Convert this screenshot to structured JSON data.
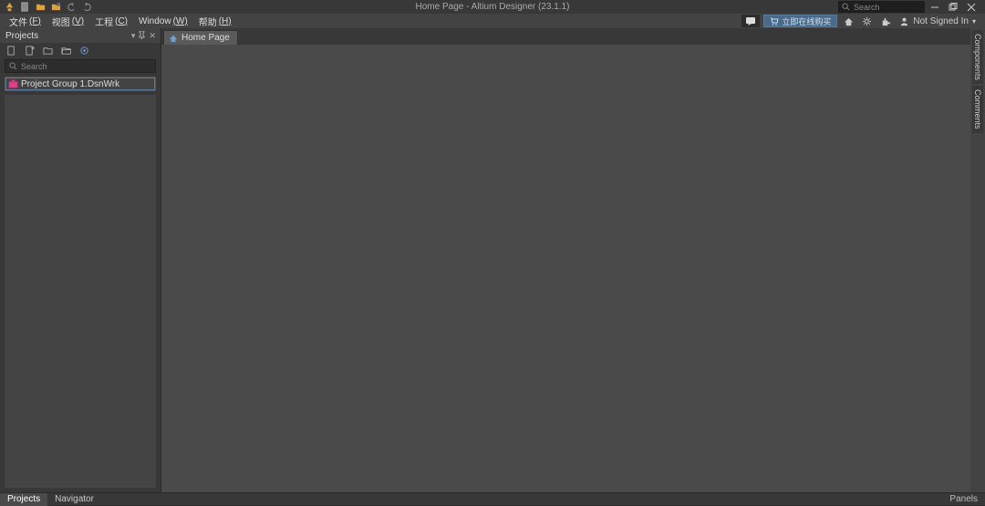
{
  "title": "Home Page - Altium Designer (23.1.1)",
  "titlebar": {
    "search_placeholder": "Search"
  },
  "menus": {
    "file": "文件",
    "file_u": "(F)",
    "view": "视图",
    "view_u": "(V)",
    "project": "工程",
    "project_u": "(C)",
    "window": "Window",
    "window_u": "(W)",
    "help": "帮助",
    "help_u": "(H)"
  },
  "menubar_right": {
    "buy_now": "立即在线购买",
    "signin": "Not Signed In",
    "signin_caret": "▾"
  },
  "projects_panel": {
    "title": "Projects",
    "search_placeholder": "Search",
    "tree": {
      "root_name": "Project Group 1.DsnWrk"
    }
  },
  "doc_tab": {
    "home_label": "Home Page"
  },
  "right_tabs": {
    "components": "Components",
    "comments": "Comments"
  },
  "bottom_tabs": {
    "projects": "Projects",
    "navigator": "Navigator"
  },
  "bottom_right": {
    "panels": "Panels"
  }
}
